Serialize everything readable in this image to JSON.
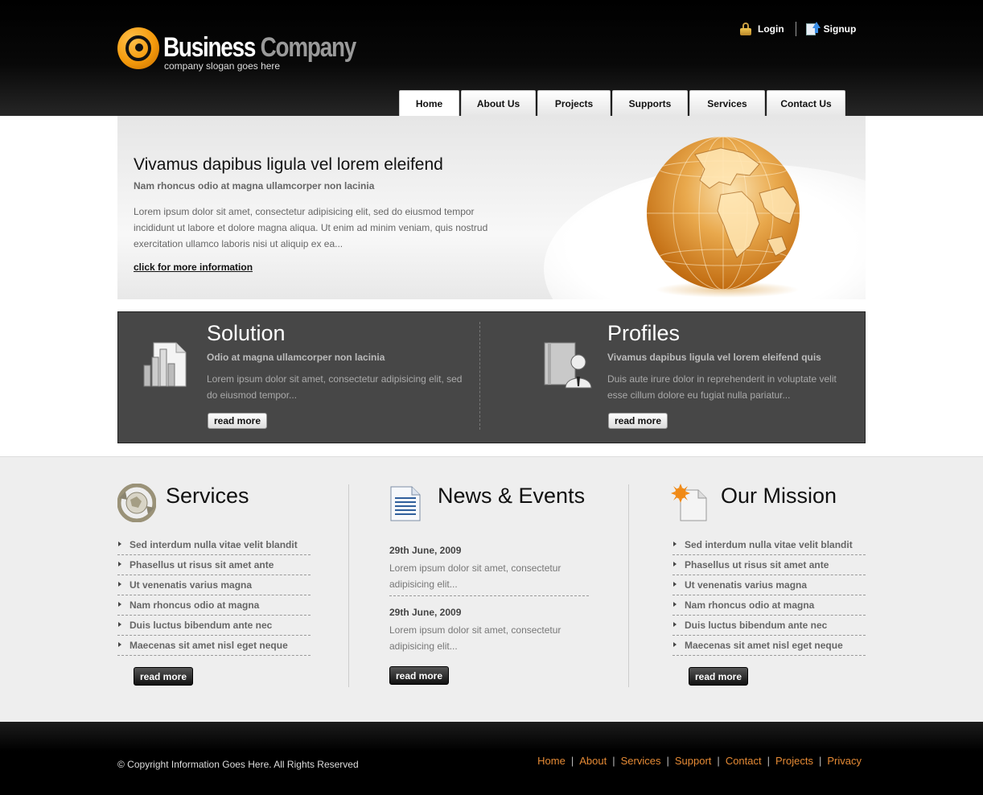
{
  "header": {
    "brand_part1": "Business",
    "brand_part2": "Company",
    "slogan": "company slogan goes here",
    "login": "Login",
    "signup": "Signup"
  },
  "nav": {
    "tabs": [
      "Home",
      "About Us",
      "Projects",
      "Supports",
      "Services",
      "Contact Us"
    ],
    "active": "Home"
  },
  "hero": {
    "title": "Vivamus dapibus ligula vel lorem eleifend",
    "subtitle": "Nam rhoncus odio at magna ullamcorper non lacinia",
    "body": "Lorem ipsum dolor sit amet, consectetur adipisicing elit, sed do eiusmod tempor incididunt ut labore et dolore magna aliqua. Ut enim ad minim veniam, quis nostrud exercitation ullamco laboris nisi ut aliquip ex ea...",
    "link": "click for more information"
  },
  "features": [
    {
      "title": "Solution",
      "subtitle": "Odio at magna ullamcorper non lacinia",
      "text": "Lorem ipsum dolor sit amet, consectetur adipisicing elit, sed do eiusmod tempor...",
      "button": "read more",
      "icon": "bar-chart-document-icon"
    },
    {
      "title": "Profiles",
      "subtitle": "Vivamus dapibus ligula vel lorem eleifend quis",
      "text": "Duis aute irure dolor in reprehenderit in voluptate velit esse cillum dolore eu fugiat nulla pariatur...",
      "button": "read more",
      "icon": "user-profile-book-icon"
    }
  ],
  "services": {
    "title": "Services",
    "icon": "recycle-globe-icon",
    "items": [
      "Sed interdum nulla vitae velit blandit",
      "Phasellus ut risus sit amet ante",
      "Ut venenatis varius magna",
      "Nam rhoncus odio at magna",
      "Duis luctus bibendum ante nec",
      "Maecenas sit amet nisl eget neque"
    ],
    "button": "read more"
  },
  "news": {
    "title": "News & Events",
    "icon": "document-lines-icon",
    "entries": [
      {
        "date": "29th June, 2009",
        "text": "Lorem ipsum dolor sit amet, consectetur adipisicing elit..."
      },
      {
        "date": "29th June, 2009",
        "text": "Lorem ipsum dolor sit amet, consectetur adipisicing elit..."
      }
    ],
    "button": "read more"
  },
  "mission": {
    "title": "Our Mission",
    "icon": "sun-document-icon",
    "items": [
      "Sed interdum nulla vitae velit blandit",
      "Phasellus ut risus sit amet ante",
      "Ut venenatis varius magna",
      "Nam rhoncus odio at magna",
      "Duis luctus bibendum ante nec",
      "Maecenas sit amet nisl eget neque"
    ],
    "button": "read more"
  },
  "footer": {
    "copyright": "© Copyright Information Goes Here. All Rights Reserved",
    "links": [
      "Home",
      "About",
      "Services",
      "Support",
      "Contact",
      "Projects",
      "Privacy"
    ]
  },
  "colors": {
    "accent_orange": "#e58a35",
    "panel_dark": "#474747",
    "header_black": "#000000"
  }
}
